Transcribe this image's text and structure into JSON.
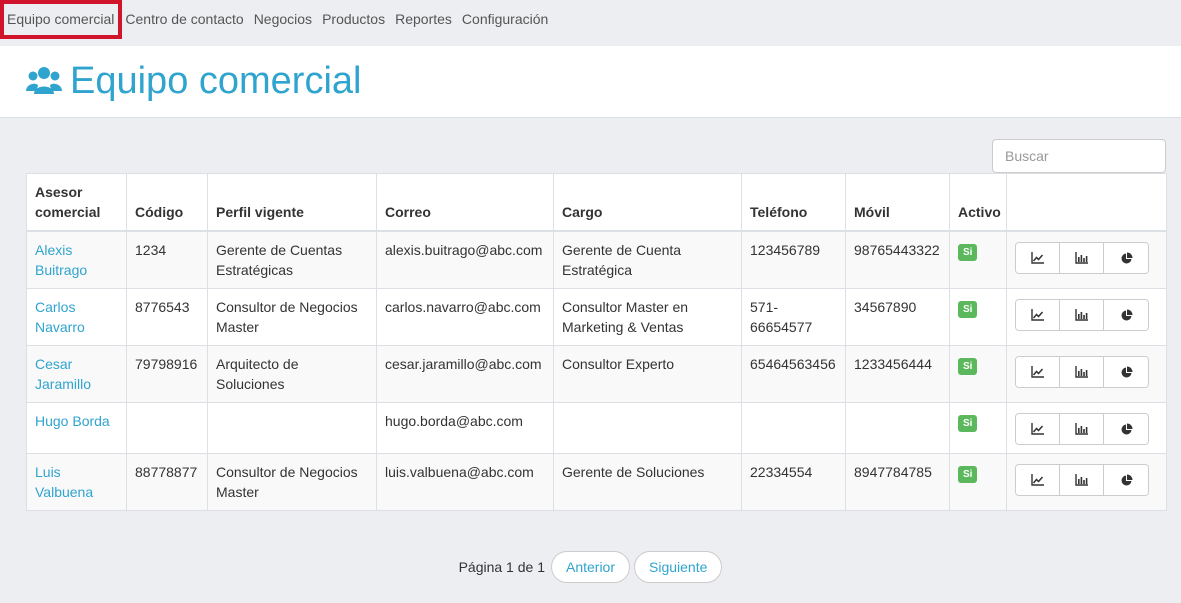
{
  "nav": {
    "items": [
      {
        "label": "Equipo comercial",
        "active": true
      },
      {
        "label": "Centro de contacto",
        "active": false
      },
      {
        "label": "Negocios",
        "active": false
      },
      {
        "label": "Productos",
        "active": false
      },
      {
        "label": "Reportes",
        "active": false
      },
      {
        "label": "Configuración",
        "active": false
      }
    ]
  },
  "header": {
    "title": "Equipo comercial",
    "icon": "users-icon"
  },
  "search": {
    "placeholder": "Buscar",
    "value": ""
  },
  "table": {
    "headers": [
      "Asesor comercial",
      "Código",
      "Perfil vigente",
      "Correo",
      "Cargo",
      "Teléfono",
      "Móvil",
      "Activo",
      ""
    ],
    "rows": [
      {
        "name": "Alexis Buitrago",
        "code": "1234",
        "profile": "Gerente de Cuentas Estratégicas",
        "email": "alexis.buitrago@abc.com",
        "role": "Gerente de Cuenta Estratégica",
        "phone": "123456789",
        "mobile": "98765443322",
        "active": "Si"
      },
      {
        "name": "Carlos Navarro",
        "code": "8776543",
        "profile": "Consultor de Negocios Master",
        "email": "carlos.navarro@abc.com",
        "role": "Consultor Master en Marketing & Ventas",
        "phone": "571-66654577",
        "mobile": "34567890",
        "active": "Si"
      },
      {
        "name": "Cesar Jaramillo",
        "code": "79798916",
        "profile": "Arquitecto de Soluciones",
        "email": "cesar.jaramillo@abc.com",
        "role": "Consultor Experto",
        "phone": "65464563456",
        "mobile": "1233456444",
        "active": "Si"
      },
      {
        "name": "Hugo Borda",
        "code": "",
        "profile": "",
        "email": "hugo.borda@abc.com",
        "role": "",
        "phone": "",
        "mobile": "",
        "active": "Si"
      },
      {
        "name": "Luis Valbuena",
        "code": "88778877",
        "profile": "Consultor de Negocios Master",
        "email": "luis.valbuena@abc.com",
        "role": "Gerente de Soluciones",
        "phone": "22334554",
        "mobile": "8947784785",
        "active": "Si"
      }
    ],
    "row_actions": [
      "line-chart-icon",
      "bar-chart-icon",
      "pie-chart-icon"
    ]
  },
  "pager": {
    "info": "Página 1 de 1",
    "prev": "Anterior",
    "next": "Siguiente"
  },
  "colors": {
    "accent": "#2fa4cf",
    "active_badge": "#5cb85c",
    "nav_highlight": "#d0142c"
  }
}
